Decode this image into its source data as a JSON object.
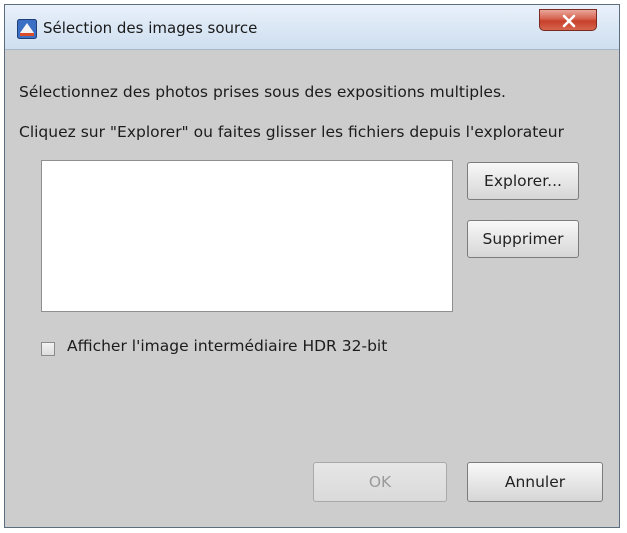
{
  "window": {
    "title": "Sélection des images source"
  },
  "instructions": {
    "line1": "Sélectionnez des photos prises sous des expositions multiples.",
    "line2": "Cliquez sur \"Explorer\" ou faites glisser les fichiers depuis l'explorateur"
  },
  "buttons": {
    "explorer": "Explorer...",
    "supprimer": "Supprimer",
    "ok": "OK",
    "annuler": "Annuler"
  },
  "options": {
    "show_hdr_label": "Afficher l'image intermédiaire HDR 32-bit",
    "show_hdr_checked": false
  },
  "icons": {
    "app": "photoshop-elements-icon",
    "close": "close-icon"
  },
  "colors": {
    "close_button": "#d6604d",
    "dialog_background": "#cdcdcd",
    "titlebar": "#dce8f5"
  }
}
